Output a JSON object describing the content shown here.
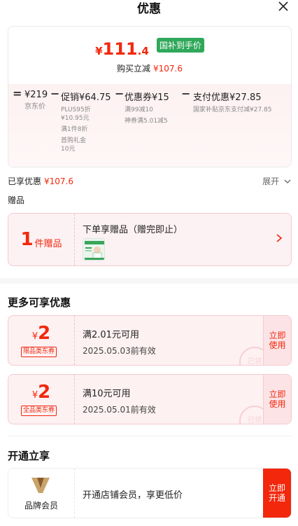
{
  "header": {
    "title": "优惠",
    "close_icon": "close-icon"
  },
  "summary": {
    "final_price": {
      "yen": "¥",
      "integer": "111",
      "decimal": ".4"
    },
    "subsidy_tag": "国补到手价",
    "instant_cut_label": "购买立减",
    "instant_cut_amount": "¥107.6",
    "ops": {
      "eq": "=",
      "minus1": "−",
      "minus2": "−",
      "minus3": "−"
    },
    "breakdown": {
      "jd_price": {
        "value": "¥219",
        "label": "京东价"
      },
      "promotion": {
        "head": "促销¥64.75",
        "lines": [
          "PLUS95折",
          "¥10.95元",
          "满1件8折",
          "首购礼金",
          "10元"
        ]
      },
      "coupon": {
        "head": "优惠券¥15",
        "lines": [
          "满99减10",
          "神券满5.01减5"
        ]
      },
      "payment": {
        "head": "支付优惠¥27.85",
        "lines": [
          "国家补贴京东支付减¥27.85"
        ]
      }
    }
  },
  "enjoyed": {
    "label": "已享优惠",
    "amount": "¥107.6",
    "expand_label": "展开"
  },
  "gift": {
    "section_label": "赠品",
    "count": "1",
    "unit": "件赠品",
    "title": "下单享赠品（赠完即止）"
  },
  "more": {
    "title": "更多可享优惠",
    "coupons": [
      {
        "yen": "¥",
        "amount": "2",
        "type": "限品类东券",
        "condition": "满2.01元可用",
        "validity": "2025.05.03前有效",
        "stamp": "已领",
        "button": "立即使用"
      },
      {
        "yen": "¥",
        "amount": "2",
        "type": "全品类东券",
        "condition": "满10元可用",
        "validity": "2025.05.01前有效",
        "stamp": "已领",
        "button": "立即使用"
      }
    ]
  },
  "membership": {
    "title": "开通立享",
    "label": "品牌会员",
    "description": "开通店铺会员，享更低价",
    "button": "立即开通"
  },
  "colors": {
    "accent": "#f2270c",
    "subsidy_green": "#2fa85a",
    "tint": "#fdf1f2"
  }
}
